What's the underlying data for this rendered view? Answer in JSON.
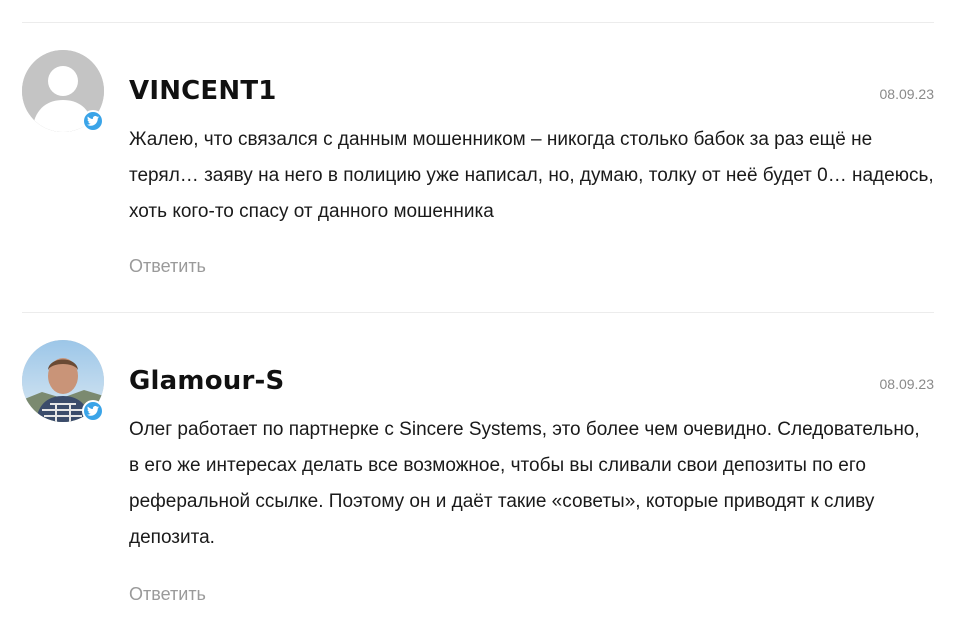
{
  "comments": [
    {
      "author": "VINCENT1",
      "date": "08.09.23",
      "text": "Жалею, что связался с данным мошенником – никогда столько бабок за раз ещё не терял… заяву на него в полицию уже написал, но, думаю, толку от неё будет 0… надеюсь, хоть кого-то спасу от данного мошенника",
      "reply_label": "Ответить",
      "avatar_icon": "default-user-silhouette",
      "badge_icon": "twitter-bird-icon"
    },
    {
      "author": "Glamour-S",
      "date": "08.09.23",
      "text": "Олег работает по партнерке с Sincere Systems, это более чем очевидно. Следовательно, в его же интересах делать все возможное, чтобы вы сливали свои депозиты по его реферальной ссылке. Поэтому он и даёт такие «советы», которые приводят к сливу депозита.",
      "reply_label": "Ответить",
      "avatar_icon": "user-photo",
      "badge_icon": "twitter-bird-icon"
    }
  ],
  "colors": {
    "badge": "#3aa4e8",
    "author": "#111111",
    "date": "#8a8a8a",
    "reply": "#9a9a9a",
    "divider": "#ececec"
  }
}
